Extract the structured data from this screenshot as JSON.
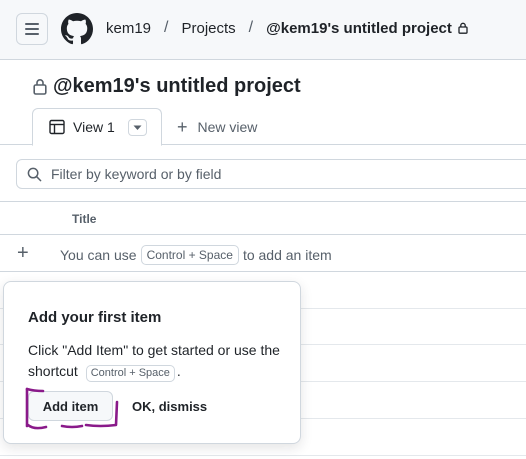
{
  "header": {
    "breadcrumbs": [
      {
        "label": "kem19",
        "bold": false
      },
      {
        "label": "Projects",
        "bold": false
      },
      {
        "label": "@kem19's untitled project",
        "bold": true
      }
    ],
    "separator": "/"
  },
  "project": {
    "title": "@kem19's untitled project"
  },
  "tabs": {
    "view_label": "View 1",
    "new_view_label": "New view"
  },
  "filter": {
    "placeholder": "Filter by keyword or by field"
  },
  "table": {
    "columns": [
      "Title"
    ],
    "add_row": {
      "prefix": "You can use",
      "shortcut": "Control + Space",
      "suffix": "to add an item"
    }
  },
  "popover": {
    "title": "Add your first item",
    "body_prefix": "Click \"Add Item\" to get started or use the shortcut",
    "shortcut": "Control + Space",
    "body_suffix": ".",
    "primary_button": "Add item",
    "secondary_button": "OK, dismiss"
  },
  "annotation": {
    "color": "#8a1a8a"
  },
  "icons": {
    "menu": "hamburger-icon",
    "logo": "github-logo",
    "lock": "lock-icon",
    "table": "table-icon",
    "caret": "chevron-down-icon",
    "plus": "plus-icon",
    "search": "search-icon"
  }
}
